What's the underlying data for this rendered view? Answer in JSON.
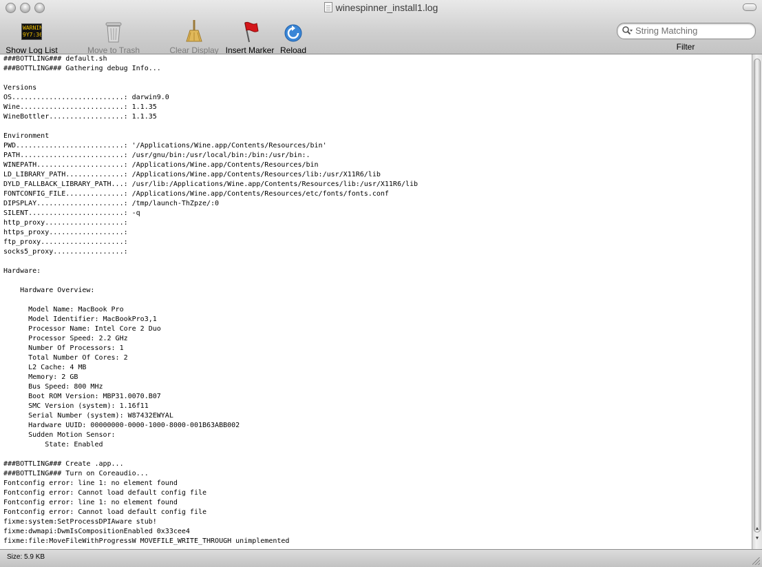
{
  "window": {
    "title": "winespinner_install1.log"
  },
  "toolbar": {
    "show_log_list": "Show Log List",
    "show_log_icon_text": "WARNIN\n9Y7:36",
    "move_to_trash": "Move to Trash",
    "clear_display": "Clear Display",
    "insert_marker": "Insert Marker",
    "reload": "Reload",
    "search_placeholder": "String Matching",
    "filter": "Filter"
  },
  "log_lines": [
    "###BOTTLING### default.sh",
    "###BOTTLING### Gathering debug Info...",
    "",
    "Versions",
    "OS...........................: darwin9.0",
    "Wine.........................: 1.1.35",
    "WineBottler..................: 1.1.35",
    "",
    "Environment",
    "PWD..........................: '/Applications/Wine.app/Contents/Resources/bin'",
    "PATH.........................: /usr/gnu/bin:/usr/local/bin:/bin:/usr/bin:.",
    "WINEPATH.....................: /Applications/Wine.app/Contents/Resources/bin",
    "LD_LIBRARY_PATH..............: /Applications/Wine.app/Contents/Resources/lib:/usr/X11R6/lib",
    "DYLD_FALLBACK_LIBRARY_PATH...: /usr/lib:/Applications/Wine.app/Contents/Resources/lib:/usr/X11R6/lib",
    "FONTCONFIG_FILE..............: /Applications/Wine.app/Contents/Resources/etc/fonts/fonts.conf",
    "DIPSPLAY.....................: /tmp/launch-ThZpze/:0",
    "SILENT.......................: -q",
    "http_proxy...................:",
    "https_proxy..................:",
    "ftp_proxy....................:",
    "socks5_proxy.................:",
    "",
    "Hardware:",
    "",
    "    Hardware Overview:",
    "",
    "      Model Name: MacBook Pro",
    "      Model Identifier: MacBookPro3,1",
    "      Processor Name: Intel Core 2 Duo",
    "      Processor Speed: 2.2 GHz",
    "      Number Of Processors: 1",
    "      Total Number Of Cores: 2",
    "      L2 Cache: 4 MB",
    "      Memory: 2 GB",
    "      Bus Speed: 800 MHz",
    "      Boot ROM Version: MBP31.0070.B07",
    "      SMC Version (system): 1.16f11",
    "      Serial Number (system): W87432EWYAL",
    "      Hardware UUID: 00000000-0000-1000-8000-001B63ABB002",
    "      Sudden Motion Sensor:",
    "          State: Enabled",
    "",
    "###BOTTLING### Create .app...",
    "###BOTTLING### Turn on Coreaudio...",
    "Fontconfig error: line 1: no element found",
    "Fontconfig error: Cannot load default config file",
    "Fontconfig error: line 1: no element found",
    "Fontconfig error: Cannot load default config file",
    "fixme:system:SetProcessDPIAware stub!",
    "fixme:dwmapi:DwmIsCompositionEnabled 0x33cee4",
    "fixme:file:MoveFileWithProgressW MOVEFILE_WRITE_THROUGH unimplemented"
  ],
  "status": {
    "size": "Size: 5.9 KB"
  }
}
